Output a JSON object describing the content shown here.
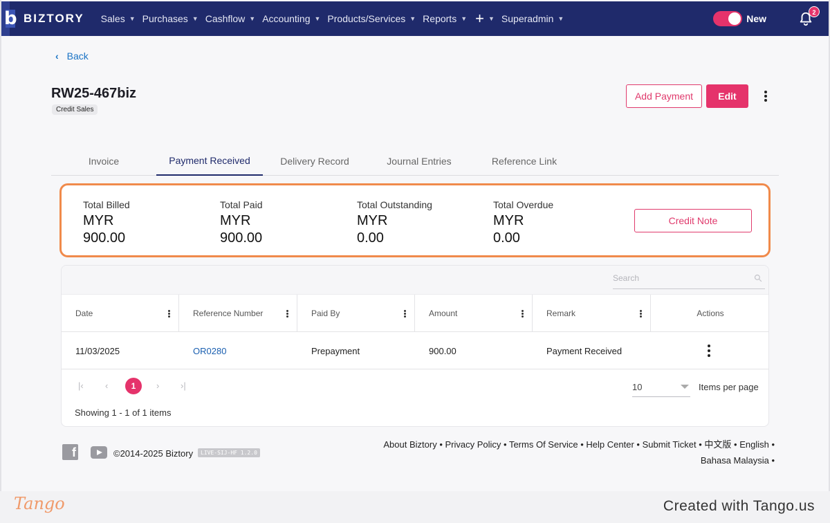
{
  "nav": {
    "brand": "BIZTORY",
    "menu": [
      {
        "label": "Sales"
      },
      {
        "label": "Purchases"
      },
      {
        "label": "Cashflow"
      },
      {
        "label": "Accounting"
      },
      {
        "label": "Products/Services"
      },
      {
        "label": "Reports"
      },
      {
        "label": "Superadmin"
      }
    ],
    "toggle_label": "New",
    "toggle_on": true,
    "notification_count": "2",
    "accent_color": "#e5336b",
    "bar_color": "#1f2a6b"
  },
  "back_label": "Back",
  "document": {
    "title": "RW25-467biz",
    "type_chip": "Credit Sales"
  },
  "actions": {
    "add_payment": "Add Payment",
    "edit": "Edit"
  },
  "tabs": [
    {
      "label": "Invoice"
    },
    {
      "label": "Payment Received",
      "active": true
    },
    {
      "label": "Delivery Record"
    },
    {
      "label": "Journal Entries"
    },
    {
      "label": "Reference Link"
    }
  ],
  "summary": {
    "items": [
      {
        "label": "Total Billed",
        "currency": "MYR",
        "amount": "900.00"
      },
      {
        "label": "Total Paid",
        "currency": "MYR",
        "amount": "900.00"
      },
      {
        "label": "Total Outstanding",
        "currency": "MYR",
        "amount": "0.00"
      },
      {
        "label": "Total Overdue",
        "currency": "MYR",
        "amount": "0.00"
      }
    ],
    "credit_note": "Credit Note"
  },
  "table": {
    "search_placeholder": "Search",
    "columns": [
      "Date",
      "Reference Number",
      "Paid By",
      "Amount",
      "Remark",
      "Actions"
    ],
    "rows": [
      {
        "date": "11/03/2025",
        "reference": "OR0280",
        "paid_by": "Prepayment",
        "amount": "900.00",
        "remark": "Payment Received"
      }
    ],
    "pagination": {
      "current_page": "1",
      "items_per_page": "10",
      "items_per_page_label": "Items per page",
      "showing": "Showing 1 - 1 of 1 items"
    }
  },
  "footer": {
    "copyright": "©2014-2025 Biztory",
    "version": "LIVE-SIJ-HF 1.2.0",
    "links": [
      "About Biztory",
      "Privacy Policy",
      "Terms Of Service",
      "Help Center",
      "Submit Ticket",
      "中文版",
      "English",
      "Bahasa Malaysia"
    ]
  },
  "tango": {
    "logo": "Tango",
    "created": "Created with Tango.us"
  }
}
